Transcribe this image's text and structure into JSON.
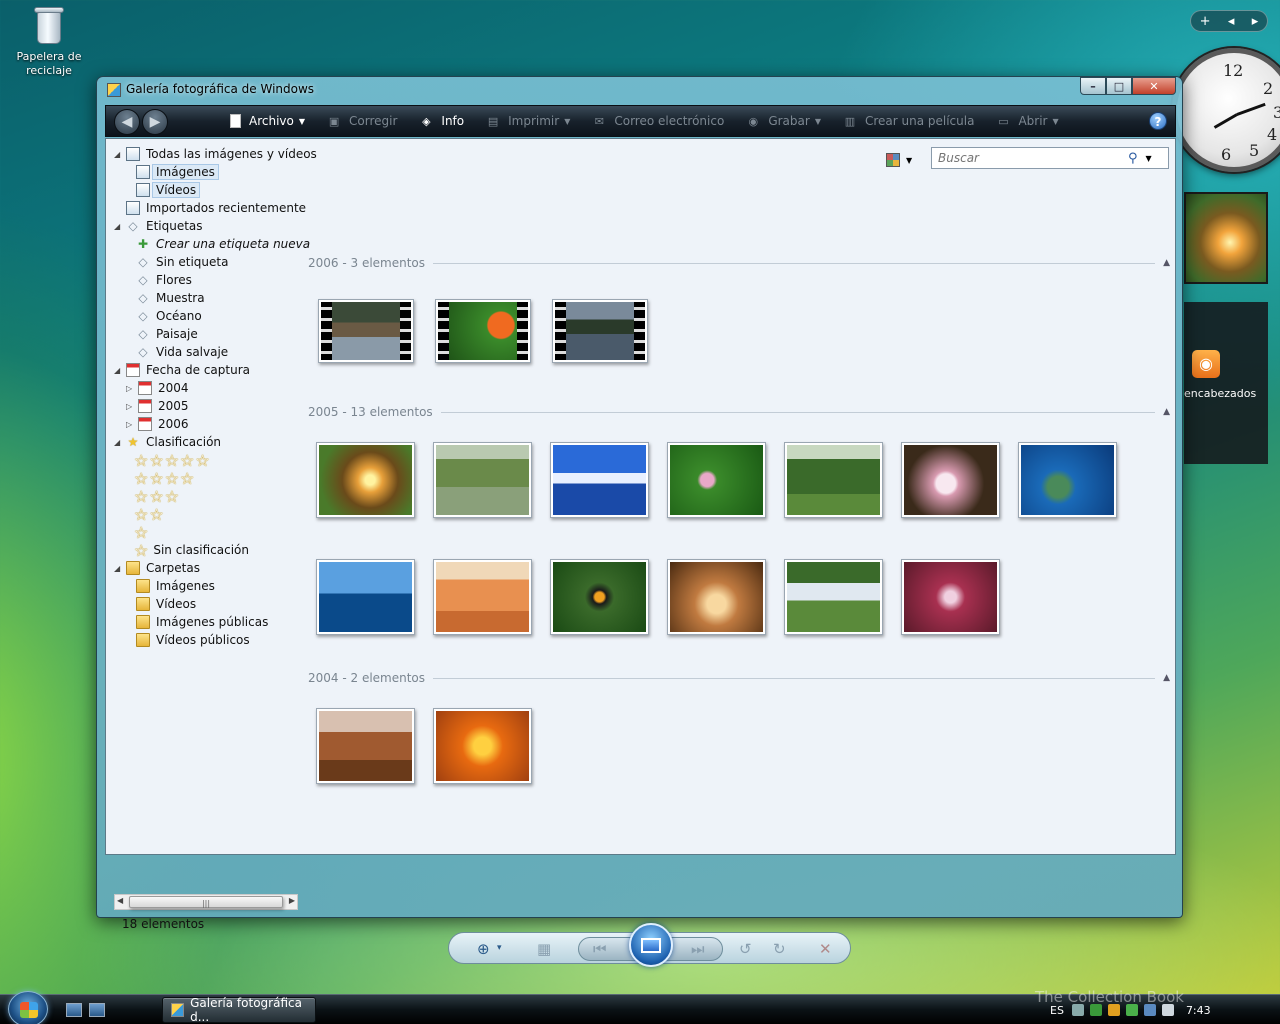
{
  "desktop": {
    "recycle_bin_label_1": "Papelera de",
    "recycle_bin_label_2": "reciclaje"
  },
  "gadgets": {
    "bar_add": "+",
    "bar_prev": "◂",
    "bar_next": "▸",
    "clock_numbers": [
      "12",
      "2",
      "3",
      "4",
      "5",
      "6"
    ],
    "rss_label": "encabezados"
  },
  "window": {
    "title": "Galería fotográfica de Windows",
    "caption_min": "–",
    "caption_max": "□",
    "caption_close": "✕"
  },
  "toolbar": {
    "back_icon": "back-arrow-icon",
    "forward_icon": "forward-arrow-icon",
    "items": [
      {
        "label": "Archivo",
        "icon": "file-icon",
        "enabled": true,
        "dropdown": true
      },
      {
        "label": "Corregir",
        "icon": "fix-icon",
        "enabled": false,
        "dropdown": false
      },
      {
        "label": "Info",
        "icon": "tag-icon",
        "enabled": true,
        "dropdown": false
      },
      {
        "label": "Imprimir",
        "icon": "printer-icon",
        "enabled": false,
        "dropdown": true
      },
      {
        "label": "Correo electrónico",
        "icon": "email-icon",
        "enabled": false,
        "dropdown": false
      },
      {
        "label": "Grabar",
        "icon": "disc-icon",
        "enabled": false,
        "dropdown": true
      },
      {
        "label": "Crear una película",
        "icon": "film-icon",
        "enabled": false,
        "dropdown": false
      },
      {
        "label": "Abrir",
        "icon": "open-icon",
        "enabled": false,
        "dropdown": true
      }
    ],
    "help": "?"
  },
  "navigation": {
    "all": "Todas las imágenes y vídeos",
    "images": "Imágenes",
    "videos": "Vídeos",
    "recent": "Importados recientemente",
    "tags": "Etiquetas",
    "create_tag": "Crear una etiqueta nueva",
    "untagged": "Sin etiqueta",
    "tag_flowers": "Flores",
    "tag_sample": "Muestra",
    "tag_ocean": "Océano",
    "tag_landscape": "Paisaje",
    "tag_wildlife": "Vida salvaje",
    "date_taken": "Fecha de captura",
    "year_2004": "2004",
    "year_2005": "2005",
    "year_2006": "2006",
    "rating": "Clasificación",
    "rating_5": "☆☆☆☆☆",
    "rating_4": "☆☆☆☆",
    "rating_3": "☆☆☆",
    "rating_2": "☆☆",
    "rating_1": "☆",
    "unrated": "Sin clasificación",
    "folders": "Carpetas",
    "folder_images": "Imágenes",
    "folder_videos": "Vídeos",
    "folder_public_images": "Imágenes públicas",
    "folder_public_videos": "Vídeos públicos",
    "scroll_grip": "|||"
  },
  "status": {
    "count": "18 elementos"
  },
  "search": {
    "placeholder": "Buscar"
  },
  "groups": [
    {
      "header": "2006 - 3 elementos",
      "count": 3,
      "type": "video"
    },
    {
      "header": "2005 - 13 elementos",
      "count": 13,
      "type": "image"
    },
    {
      "header": "2004 - 2 elementos",
      "count": 2,
      "type": "image"
    }
  ],
  "thumbnails": {
    "g2006": [
      "linear-gradient(#3b4a38 0 35%, #6a5a44 35% 60%, #8a9aa8 60%)",
      "radial-gradient(circle at 70% 40%, #f06a20 0 18%, #3a8a2a 20%, #1a4a14 100%)",
      "linear-gradient(#7a8a9a 0 30%, #2a3a2a 30% 55%, #4a5a6a 55%)"
    ],
    "g2005": [
      "radial-gradient(circle at 55% 50%, #fff3a0 0 8%, #e8a03a 20%, #6a4a1a 45%, #4a7a2a 80%)",
      "linear-gradient(#b9c9b0 0 20%, #6a8a4a 20% 60%, #8aa07a 60%)",
      "linear-gradient(#2a6ad8 0 40%, #e8f0ff 40% 55%, #1a4aa8 55%)",
      "radial-gradient(circle at 40% 50%, #e8a8c8 0 10%, #3a8a2a 15%, #1a5a14 100%)",
      "linear-gradient(#c8d8c0 0 20%, #3a6a2a 20% 70%, #5a8a3a 70%)",
      "radial-gradient(circle at 45% 55%, #f8e8f0 0 15%, #d89ab0 20%, #3a2a1a 60%)",
      "radial-gradient(circle at 40% 60%, #4a8a5a 0 15%, #1a6ab8 25%, #0a3a7a 100%)",
      "linear-gradient(#5aa0e0 0 45%, #0a4a8a 45%)",
      "linear-gradient(#f0d8b8 0 25%, #e89050 25% 70%, #c86a30 70%)",
      "radial-gradient(circle at 50% 50%, #f0a020 0 8%, #1a1a1a 12%, #3a6a2a 25%, #1a4a14 100%)",
      "radial-gradient(circle at 50% 60%, #f8d8a0 0 15%, #c07a40 35%, #4a2a10 100%)",
      "linear-gradient(#3a6a2a 0 30%, #e0e8f0 30% 55%, #5a8a3a 55%)",
      "radial-gradient(circle at 50% 50%, #f0d0e0 0 10%, #a83050 25%, #5a1a2a 100%)"
    ],
    "g2004": [
      "linear-gradient(#d8c0b0 0 30%, #a05a30 30% 70%, #6a3a1a 70%)",
      "radial-gradient(circle at 50% 50%, #ffd040 0 15%, #e86a10 35%, #a04010 100%)"
    ]
  },
  "controls": {
    "zoom": "⊕",
    "zoom_caret": "▾",
    "thumbs": "▦",
    "prev": "⏮",
    "next": "⏭",
    "rotate_left": "↺",
    "rotate_right": "↻",
    "delete": "✕"
  },
  "taskbar": {
    "task_label": "Galería fotográfica d...",
    "language": "ES",
    "time": "7:43"
  },
  "watermark": "The Collection Book"
}
